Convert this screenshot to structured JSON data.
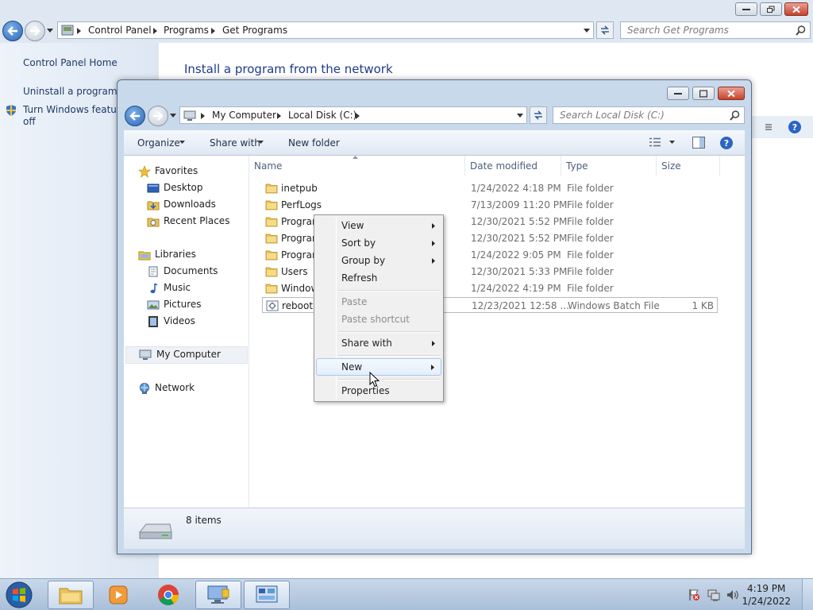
{
  "background_window": {
    "breadcrumb": [
      "Control Panel",
      "Programs",
      "Get Programs"
    ],
    "search_placeholder": "Search Get Programs",
    "sidebar": {
      "home": "Control Panel Home",
      "uninstall": "Uninstall a program",
      "features_line1": "Turn Windows features",
      "features_line2": "off"
    },
    "heading": "Install a program from the network"
  },
  "explorer": {
    "breadcrumb": [
      "My Computer",
      "Local Disk (C:)"
    ],
    "search_placeholder": "Search Local Disk (C:)",
    "toolbar": {
      "organize": "Organize",
      "share_with": "Share with",
      "new_folder": "New folder"
    },
    "nav": {
      "favorites": "Favorites",
      "desktop": "Desktop",
      "downloads": "Downloads",
      "recent_places": "Recent Places",
      "libraries": "Libraries",
      "documents": "Documents",
      "music": "Music",
      "pictures": "Pictures",
      "videos": "Videos",
      "my_computer": "My Computer",
      "network": "Network"
    },
    "columns": {
      "name": "Name",
      "date_modified": "Date modified",
      "type": "Type",
      "size": "Size"
    },
    "files": [
      {
        "name": "inetpub",
        "date": "1/24/2022 4:18 PM",
        "type": "File folder",
        "size": ""
      },
      {
        "name": "PerfLogs",
        "date": "7/13/2009 11:20 PM",
        "type": "File folder",
        "size": ""
      },
      {
        "name": "Program",
        "date": "12/30/2021 5:52 PM",
        "type": "File folder",
        "size": ""
      },
      {
        "name": "Program",
        "date": "12/30/2021 5:52 PM",
        "type": "File folder",
        "size": ""
      },
      {
        "name": "Program",
        "date": "1/24/2022 9:05 PM",
        "type": "File folder",
        "size": ""
      },
      {
        "name": "Users",
        "date": "12/30/2021 5:33 PM",
        "type": "File folder",
        "size": ""
      },
      {
        "name": "Window",
        "date": "1/24/2022 4:19 PM",
        "type": "File folder",
        "size": ""
      },
      {
        "name": "reboot",
        "date": "12/23/2021 12:58 ...",
        "type": "Windows Batch File",
        "size": "1 KB"
      }
    ],
    "status": "8 items"
  },
  "context_menu": {
    "view": "View",
    "sort_by": "Sort by",
    "group_by": "Group by",
    "refresh": "Refresh",
    "paste": "Paste",
    "paste_shortcut": "Paste shortcut",
    "share_with": "Share with",
    "new": "New",
    "properties": "Properties"
  },
  "taskbar": {
    "time": "4:19 PM",
    "date": "1/24/2022"
  },
  "colors": {
    "accent": "#1e3a8a",
    "folder": "#e9c45a",
    "menu_hot": "#a8c8ec"
  }
}
